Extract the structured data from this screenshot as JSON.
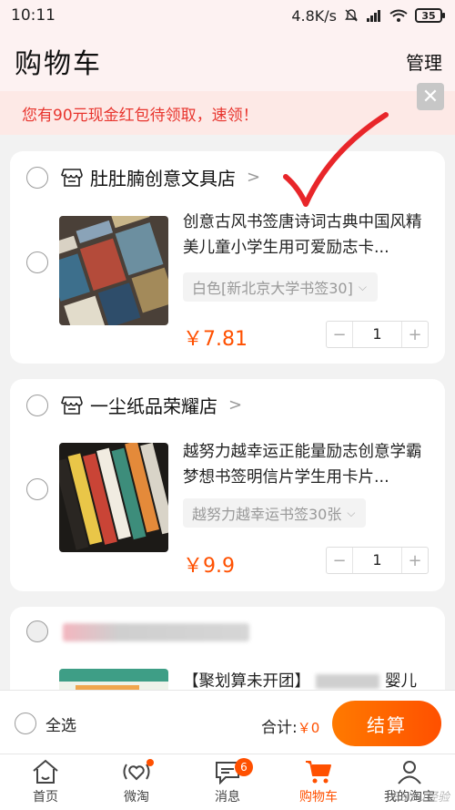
{
  "status": {
    "time": "10:11",
    "speed": "4.8K/s",
    "battery": "35"
  },
  "header": {
    "title": "购物车",
    "manage": "管理"
  },
  "promo": {
    "text": "您有90元现金红包待领取，速领！",
    "close": "✕"
  },
  "shops": [
    {
      "name": "肚肚腩创意文具店",
      "item": {
        "title": "创意古风书签唐诗词古典中国风精美儿童小学生用可爱励志卡...",
        "variant": "白色[新北京大学书签30]",
        "price": "￥7.81",
        "qty": "1"
      }
    },
    {
      "name": "一尘纸品荣耀店",
      "item": {
        "title": "越努力越幸运正能量励志创意学霸梦想书签明信片学生用卡片...",
        "variant": "越努力越幸运书签30张",
        "price": "￥9.9",
        "qty": "1"
      }
    },
    {
      "item": {
        "title_prefix": "【聚划算未开团】",
        "title_suffix": "婴儿"
      }
    }
  ],
  "footer": {
    "select_all": "全选",
    "total_label": "合计:",
    "total_value": "￥0",
    "checkout": "结算"
  },
  "tabs": [
    {
      "label": "首页",
      "icon": "home-icon"
    },
    {
      "label": "微淘",
      "icon": "heart-broadcast-icon"
    },
    {
      "label": "消息",
      "icon": "message-icon",
      "badge": "6"
    },
    {
      "label": "购物车",
      "icon": "cart-icon",
      "active": true
    },
    {
      "label": "我的淘宝",
      "icon": "user-icon"
    }
  ],
  "watermark": "Baidu经验",
  "colors": {
    "accent": "#ff5000",
    "promo_text": "#e8352e",
    "checkmark": "#e8262a"
  }
}
